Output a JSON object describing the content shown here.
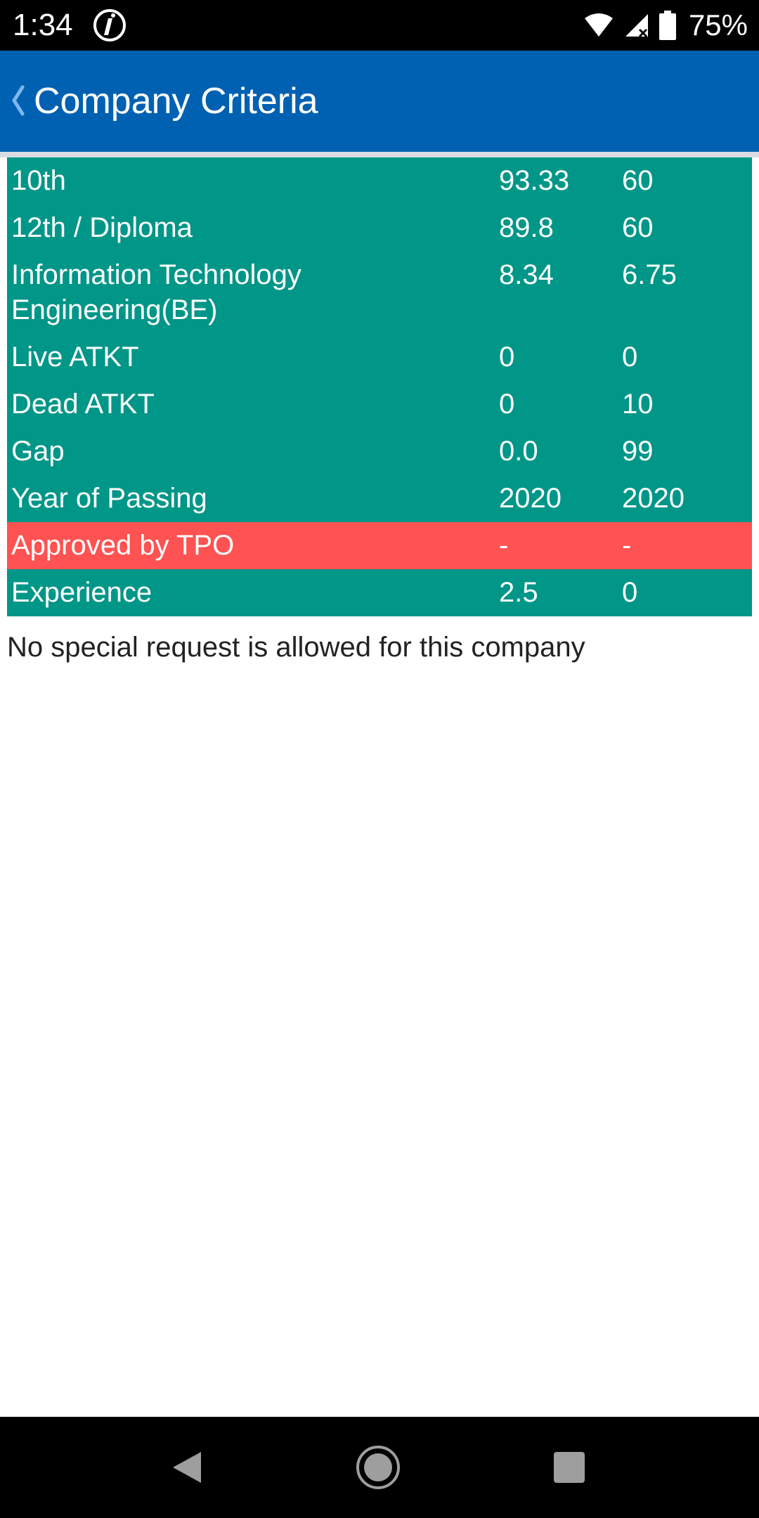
{
  "status_bar": {
    "time": "1:34",
    "battery": "75%"
  },
  "app_bar": {
    "title": "Company Criteria"
  },
  "criteria": [
    {
      "label": "10th",
      "actual": "93.33",
      "required": "60",
      "status": "ok"
    },
    {
      "label": "12th / Diploma",
      "actual": "89.8",
      "required": "60",
      "status": "ok"
    },
    {
      "label": "Information Technology Engineering(BE)",
      "actual": "8.34",
      "required": "6.75",
      "status": "ok"
    },
    {
      "label": "Live ATKT",
      "actual": "0",
      "required": "0",
      "status": "ok"
    },
    {
      "label": "Dead ATKT",
      "actual": "0",
      "required": "10",
      "status": "ok"
    },
    {
      "label": "Gap",
      "actual": "0.0",
      "required": "99",
      "status": "ok"
    },
    {
      "label": "Year of Passing",
      "actual": "2020",
      "required": "2020",
      "status": "ok"
    },
    {
      "label": "Approved by TPO",
      "actual": "-",
      "required": "-",
      "status": "bad"
    },
    {
      "label": "Experience",
      "actual": "2.5",
      "required": "0",
      "status": "ok"
    }
  ],
  "footer_note": "No special request is allowed for this company",
  "colors": {
    "app_bar": "#0061b2",
    "row_ok": "#009688",
    "row_bad": "#ff5252"
  }
}
